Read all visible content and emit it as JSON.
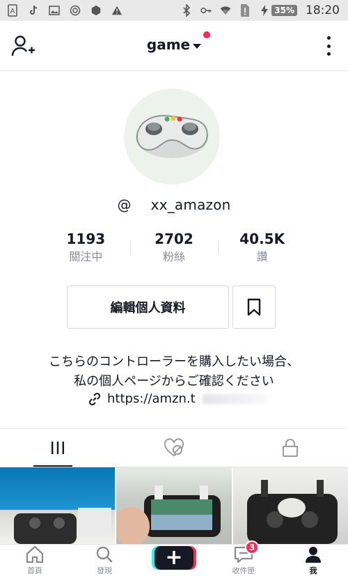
{
  "status_bar": {
    "time": "18:20",
    "battery": "35%",
    "icons": [
      "a-notification-icon",
      "tiktok-icon",
      "image-icon",
      "ring-icon",
      "hexagon-icon",
      "warning-icon",
      "bluetooth-icon",
      "key-icon",
      "wifi-icon",
      "sim-icon",
      "charging-icon"
    ]
  },
  "header": {
    "title": "game",
    "left_icon": "add-user-icon",
    "right_icon": "more-vertical-icon"
  },
  "profile": {
    "at_sign": "@",
    "username": "xx_amazon",
    "stats": [
      {
        "value": "1193",
        "label": "關注中"
      },
      {
        "value": "2702",
        "label": "粉絲"
      },
      {
        "value": "40.5K",
        "label": "讚"
      }
    ],
    "edit_button": "編輯個人資料",
    "bio_lines": [
      "こちらのコントローラーを購入したい場合、",
      "私の個人ページからご確認ください"
    ],
    "link": "https://amzn.t"
  },
  "tabs": [
    {
      "name": "videos-tab",
      "icon": "grid-icon",
      "active": true
    },
    {
      "name": "liked-tab",
      "icon": "heart-hidden-icon",
      "active": false
    },
    {
      "name": "private-tab",
      "icon": "lock-icon",
      "active": false
    }
  ],
  "bottom_nav": {
    "items": [
      {
        "label": "首頁",
        "icon": "home-icon"
      },
      {
        "label": "發現",
        "icon": "search-icon"
      },
      {
        "label": "",
        "icon": "plus-icon"
      },
      {
        "label": "收件匣",
        "icon": "inbox-icon",
        "badge": "3"
      },
      {
        "label": "我",
        "icon": "profile-icon"
      }
    ]
  },
  "colors": {
    "accent_red": "#fe2c55",
    "accent_cyan": "#25f4ee",
    "text": "#161823",
    "muted": "#8a8b91"
  }
}
